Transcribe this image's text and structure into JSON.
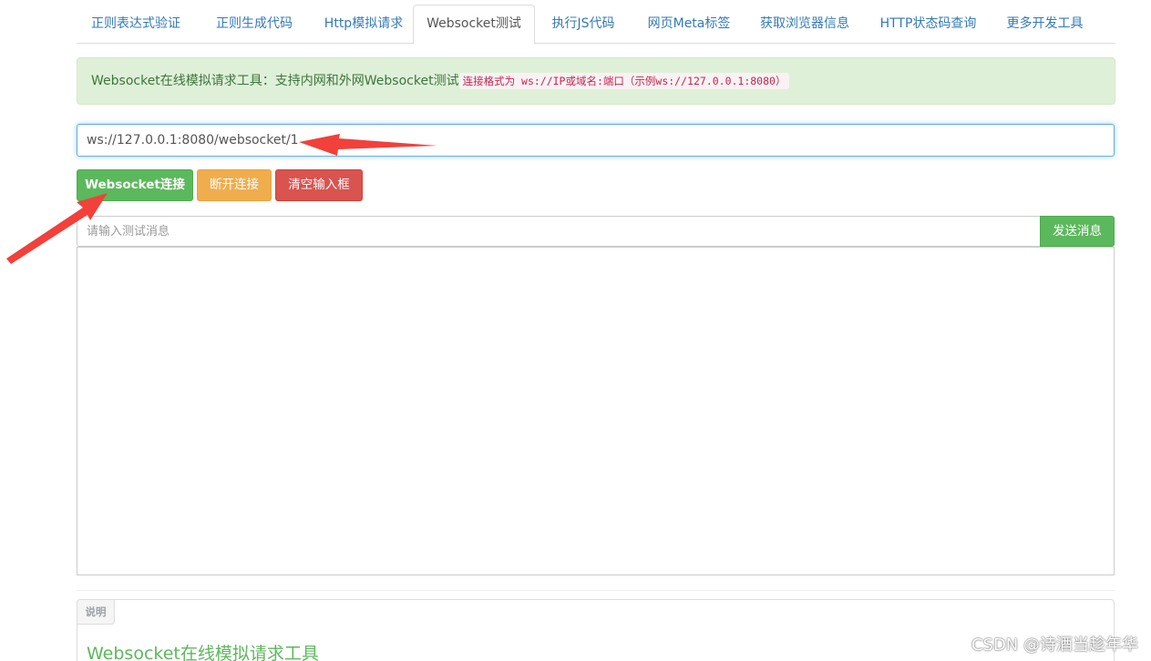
{
  "tabs": [
    {
      "label": "正则表达式验证"
    },
    {
      "label": "正则生成代码"
    },
    {
      "label": "Http模拟请求"
    },
    {
      "label": "Websocket测试"
    },
    {
      "label": "执行JS代码"
    },
    {
      "label": "网页Meta标签"
    },
    {
      "label": "获取浏览器信息"
    },
    {
      "label": "HTTP状态码查询"
    },
    {
      "label": "更多开发工具"
    }
  ],
  "active_tab_index": 3,
  "alert": {
    "text": "Websocket在线模拟请求工具：支持内网和外网Websocket测试",
    "code": "连接格式为 ws://IP或域名:端口（示例ws://127.0.0.1:8080）"
  },
  "url_input": {
    "value": "ws://127.0.0.1:8080/websocket/1"
  },
  "buttons": {
    "connect": "Websocket连接",
    "disconnect": "断开连接",
    "clear": "清空输入框",
    "send": "发送消息"
  },
  "message_input": {
    "placeholder": "请输入测试消息"
  },
  "output": {
    "value": ""
  },
  "panel": {
    "label": "说明",
    "title": "Websocket在线模拟请求工具"
  },
  "watermark": "CSDN @诗酒当趁年华",
  "colors": {
    "link": "#337ab7",
    "success": "#5cb85c",
    "warning": "#f0ad4e",
    "danger": "#d9534f",
    "alert_bg": "#dff0d8",
    "arrow": "#f2403a"
  }
}
